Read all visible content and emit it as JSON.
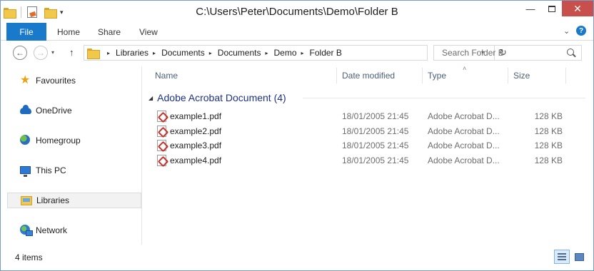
{
  "window": {
    "title": "C:\\Users\\Peter\\Documents\\Demo\\Folder B",
    "close_glyph": "✕",
    "minimize_glyph": "—"
  },
  "ribbon": {
    "file_label": "File",
    "tabs": [
      "Home",
      "Share",
      "View"
    ],
    "help_glyph": "?",
    "expand_glyph": "⌄",
    "accent_color": "#1979ca"
  },
  "navigation": {
    "back_glyph": "←",
    "forward_glyph": "→",
    "recent_glyph": "▾",
    "up_glyph": "↑",
    "breadcrumbs": [
      "Libraries",
      "Documents",
      "Documents",
      "Demo",
      "Folder B"
    ],
    "breadcrumb_separator": "▸",
    "refresh_glyph": "↻",
    "search_placeholder": "Search Folder B"
  },
  "nav_pane": {
    "items": [
      {
        "label": "Favourites",
        "icon": "star-icon"
      },
      {
        "label": "OneDrive",
        "icon": "cloud-icon"
      },
      {
        "label": "Homegroup",
        "icon": "homegroup-icon"
      },
      {
        "label": "This PC",
        "icon": "computer-icon"
      },
      {
        "label": "Libraries",
        "icon": "libraries-icon",
        "selected": true
      },
      {
        "label": "Network",
        "icon": "network-icon"
      }
    ]
  },
  "file_list": {
    "columns": [
      "Name",
      "Date modified",
      "Type",
      "Size"
    ],
    "sort_glyph": "˄",
    "group": {
      "label": "Adobe Acrobat Document (4)",
      "collapse_glyph": "◢"
    },
    "files": [
      {
        "name": "example1.pdf",
        "date": "18/01/2005 21:45",
        "type": "Adobe Acrobat D...",
        "size": "128 KB"
      },
      {
        "name": "example2.pdf",
        "date": "18/01/2005 21:45",
        "type": "Adobe Acrobat D...",
        "size": "128 KB"
      },
      {
        "name": "example3.pdf",
        "date": "18/01/2005 21:45",
        "type": "Adobe Acrobat D...",
        "size": "128 KB"
      },
      {
        "name": "example4.pdf",
        "date": "18/01/2005 21:45",
        "type": "Adobe Acrobat D...",
        "size": "128 KB"
      }
    ]
  },
  "status": {
    "item_count": "4 items"
  }
}
